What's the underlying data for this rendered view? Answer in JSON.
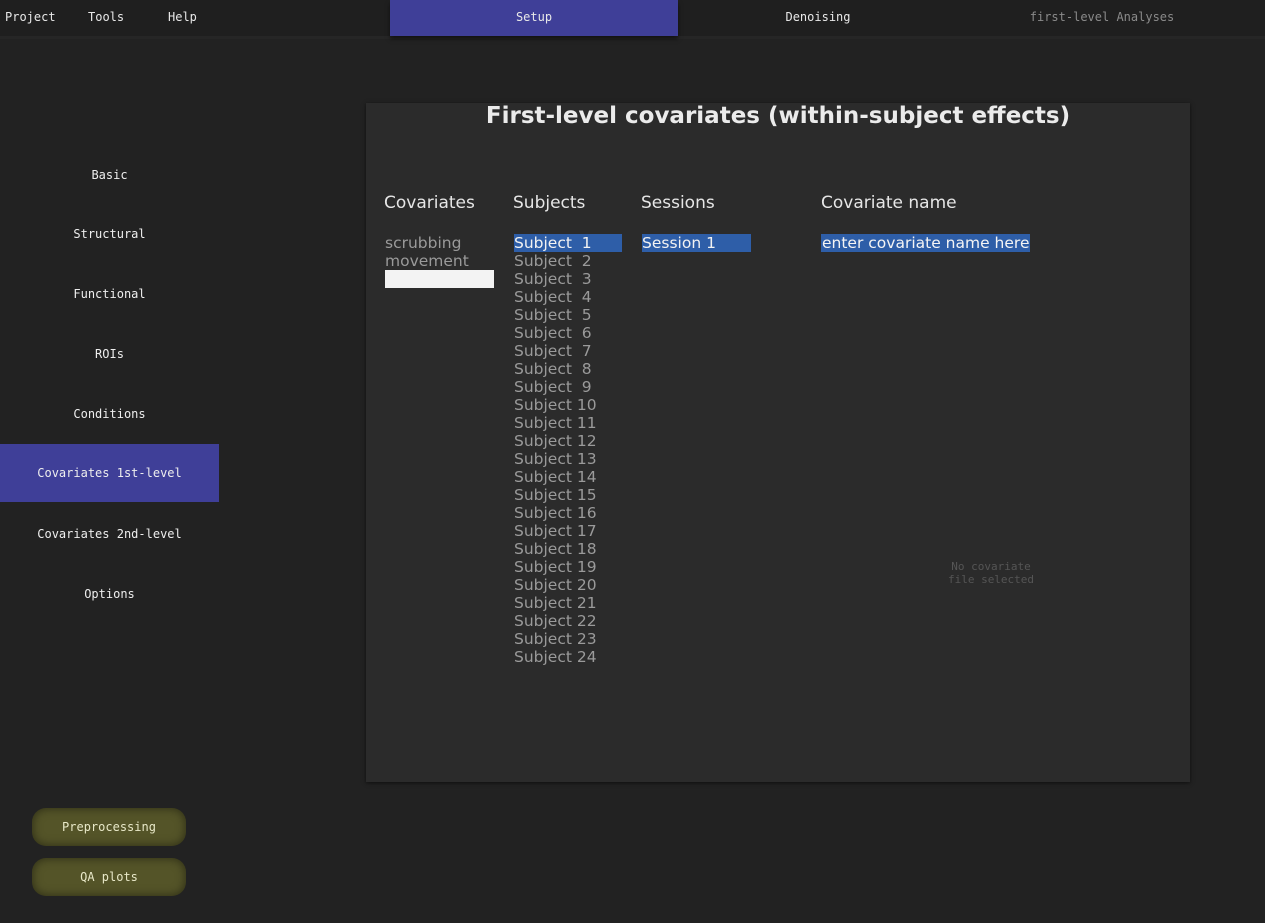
{
  "menu": {
    "project": "Project",
    "tools": "Tools",
    "help": "Help"
  },
  "tabs": {
    "setup": "Setup",
    "denoising": "Denoising",
    "first_level": "first-level Analyses"
  },
  "sidebar": {
    "items": [
      {
        "label": "Basic"
      },
      {
        "label": "Structural"
      },
      {
        "label": "Functional"
      },
      {
        "label": "ROIs"
      },
      {
        "label": "Conditions"
      },
      {
        "label": "Covariates 1st-level"
      },
      {
        "label": "Covariates 2nd-level"
      },
      {
        "label": "Options"
      }
    ]
  },
  "bottom": {
    "preprocessing": "Preprocessing",
    "qa_plots": "QA plots"
  },
  "panel": {
    "title": "First-level covariates (within-subject effects)",
    "headers": {
      "covariates": "Covariates",
      "subjects": "Subjects",
      "sessions": "Sessions",
      "covariate_name": "Covariate name"
    },
    "covariates": [
      "scrubbing",
      "movement"
    ],
    "subjects": [
      "Subject  1",
      "Subject  2",
      "Subject  3",
      "Subject  4",
      "Subject  5",
      "Subject  6",
      "Subject  7",
      "Subject  8",
      "Subject  9",
      "Subject 10",
      "Subject 11",
      "Subject 12",
      "Subject 13",
      "Subject 14",
      "Subject 15",
      "Subject 16",
      "Subject 17",
      "Subject 18",
      "Subject 19",
      "Subject 20",
      "Subject 21",
      "Subject 22",
      "Subject 23",
      "Subject 24"
    ],
    "sessions": [
      "Session 1"
    ],
    "covariate_name_value": "enter covariate name here",
    "no_file_line1": "No covariate",
    "no_file_line2": "file selected"
  },
  "colors": {
    "accent": "#3f3f98",
    "selection": "#2e5ea8",
    "button": "#545428"
  }
}
